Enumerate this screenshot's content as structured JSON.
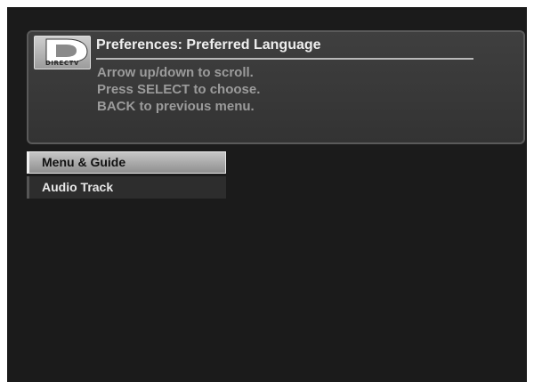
{
  "header": {
    "logo_text": "DIRECTV",
    "title": "Preferences: Preferred Language",
    "instructions": [
      "Arrow up/down to scroll.",
      "Press SELECT to choose.",
      "BACK to previous menu."
    ]
  },
  "menu": {
    "items": [
      {
        "label": "Menu & Guide",
        "selected": true
      },
      {
        "label": "Audio Track",
        "selected": false
      }
    ]
  },
  "colors": {
    "screen_background": "#1b1b1b",
    "panel_background": "#3a3a3a",
    "selected_highlight": "#b0b0b0"
  }
}
